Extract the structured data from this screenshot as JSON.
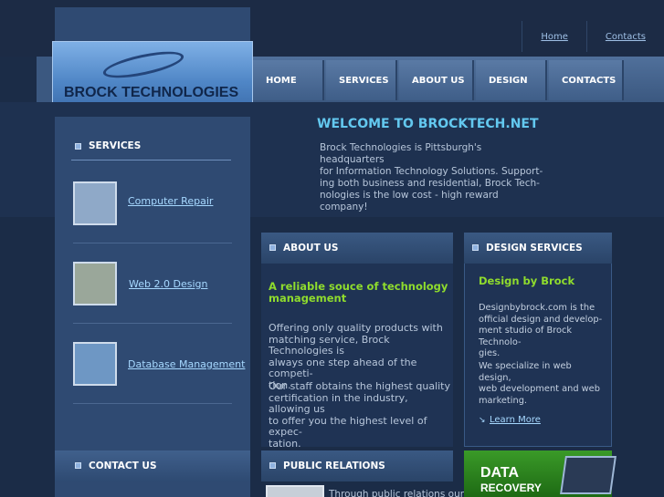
{
  "top_links": [
    "Home",
    "Contacts"
  ],
  "logo": {
    "text": "BROCK TECHNOLOGIES"
  },
  "nav": [
    "HOME",
    "SERVICES",
    "ABOUT US",
    "DESIGN",
    "CONTACTS"
  ],
  "welcome": {
    "title": "WELCOME TO BROCKTECH.NET",
    "lines": [
      "Brock Technologies is Pittsburgh's headquarters",
      "for Information Technology Solutions. Support-",
      "ing both business and residential, Brock Tech-",
      "nologies is the low cost - high reward company!"
    ]
  },
  "services": {
    "title": "SERVICES",
    "items": [
      "Computer Repair",
      "Web 2.0 Design",
      "Database Management"
    ]
  },
  "contact": {
    "title": "CONTACT US"
  },
  "about": {
    "title": "ABOUT US",
    "subtitle_lines": [
      "A reliable souce of technology",
      "management"
    ],
    "p1": [
      "Offering only quality products with",
      "matching service, Brock Technologies is",
      "always one step ahead of the competi-",
      "tion."
    ],
    "p2": [
      "Our staff obtains the highest quality",
      "certification in the industry, allowing us",
      "to offer you the highest level of expec-",
      "tation."
    ]
  },
  "design": {
    "title": "DESIGN SERVICES",
    "subtitle": "Design by Brock",
    "p1": [
      "Designbybrock.com is the",
      "official design and develop-",
      "ment studio of Brock Technolo-",
      "gies."
    ],
    "p2": [
      "We specialize in web design,",
      "web development and web",
      "marketing."
    ],
    "learn_more": "Learn More"
  },
  "public_relations": {
    "title": "PUBLIC RELATIONS",
    "text": "Through public relations our"
  },
  "recovery": {
    "line1": "DATA",
    "line2": "RECOVERY"
  }
}
